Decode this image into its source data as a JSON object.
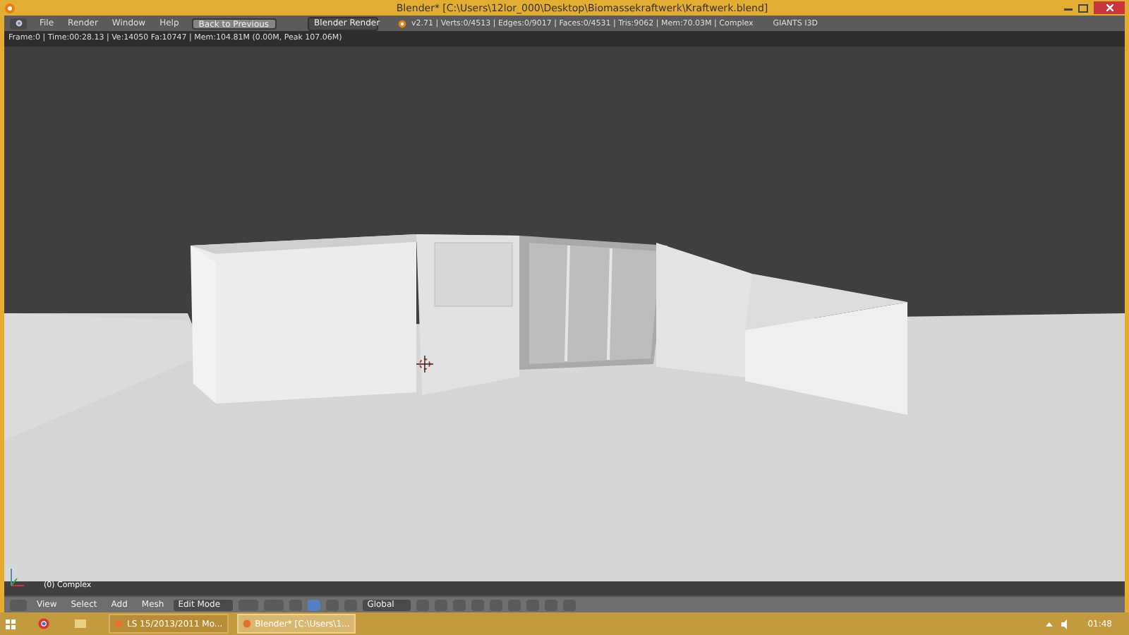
{
  "window": {
    "title": "Blender* [C:\\Users\\12lor_000\\Desktop\\Biomassekraftwerk\\Kraftwerk.blend]"
  },
  "menu_bar": {
    "menus": [
      "File",
      "Render",
      "Window",
      "Help"
    ],
    "back_button": "Back to Previous",
    "render_engine": "Blender Render",
    "stats": "v2.71 | Verts:0/4513 | Edges:0/9017 | Faces:0/4531 | Tris:9062 | Mem:70.03M | Complex",
    "addon_label": "GIANTS I3D"
  },
  "viewport": {
    "info": "Frame:0 | Time:00:28.13 | Ve:14050 Fa:10747 | Mem:104.81M (0.00M, Peak 107.06M)",
    "object_label": "(0) Complex"
  },
  "header_3d": {
    "menus": [
      "View",
      "Select",
      "Add",
      "Mesh"
    ],
    "mode": "Edit Mode",
    "orientation": "Global",
    "select_modes": [
      {
        "selected": true
      },
      {
        "selected": false
      },
      {
        "selected": false
      }
    ]
  },
  "taskbar": {
    "items": [
      {
        "label": "LS 15/2013/2011 Mo...",
        "selected": false
      },
      {
        "label": "Blender* [C:\\Users\\1...",
        "selected": true
      }
    ],
    "clock": "01:48"
  }
}
